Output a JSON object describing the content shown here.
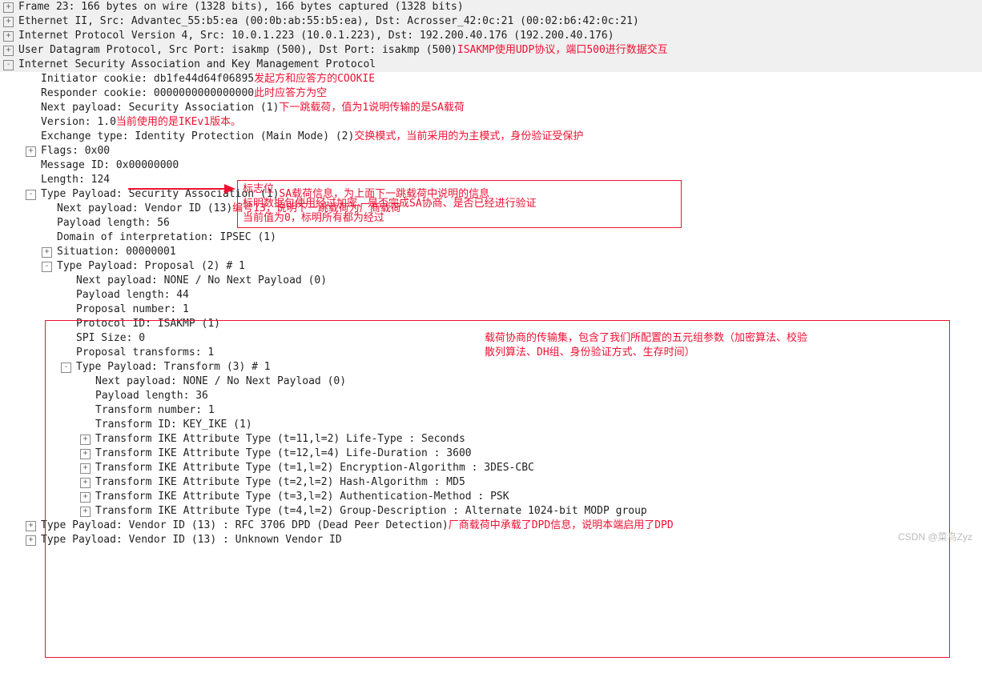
{
  "watermark": "CSDN @菜鸟Zyz",
  "lines": [
    {
      "hdr": true,
      "toggle": "+",
      "indent": 0,
      "text": "Frame 23: 166 bytes on wire (1328 bits), 166 bytes captured (1328 bits)"
    },
    {
      "hdr": true,
      "toggle": "+",
      "indent": 0,
      "text": "Ethernet II, Src: Advantec_55:b5:ea (00:0b:ab:55:b5:ea), Dst: Acrosser_42:0c:21 (00:02:b6:42:0c:21)"
    },
    {
      "hdr": true,
      "toggle": "+",
      "indent": 0,
      "text": "Internet Protocol Version 4, Src: 10.0.1.223 (10.0.1.223), Dst: 192.200.40.176 (192.200.40.176)"
    },
    {
      "hdr": true,
      "toggle": "+",
      "indent": 0,
      "text": "User Datagram Protocol, Src Port: isakmp (500), Dst Port: isakmp (500)",
      "annot": "ISAKMP使用UDP协议，端口500进行数据交互"
    },
    {
      "hdr": true,
      "toggle": "-",
      "indent": 0,
      "text": "Internet Security Association and Key Management Protocol"
    },
    {
      "hdr": false,
      "toggle": " ",
      "indent": 1,
      "text": "Initiator cookie: db1fe44d64f06895",
      "annot": "发起方和应答方的COOKIE"
    },
    {
      "hdr": false,
      "toggle": " ",
      "indent": 1,
      "text": "Responder cookie: 0000000000000000",
      "annot": "此时应答方为空"
    },
    {
      "hdr": false,
      "toggle": " ",
      "indent": 1,
      "text": "Next payload: Security Association (1)",
      "annot": "  下一跳载荷，值为1说明传输的是SA载荷"
    },
    {
      "hdr": false,
      "toggle": " ",
      "indent": 1,
      "text": "Version: 1.0",
      "annot": " 当前使用的是IKEv1版本。"
    },
    {
      "hdr": false,
      "toggle": " ",
      "indent": 1,
      "text": "Exchange type: Identity Protection (Main Mode) (2)",
      "annot": "交换模式，当前采用的为主模式，身份验证受保护"
    },
    {
      "hdr": false,
      "toggle": "+",
      "indent": 1,
      "text": "Flags: 0x00"
    },
    {
      "hdr": false,
      "toggle": " ",
      "indent": 1,
      "text": "Message ID: 0x00000000"
    },
    {
      "hdr": false,
      "toggle": " ",
      "indent": 1,
      "text": "Length: 124"
    },
    {
      "hdr": false,
      "toggle": "-",
      "indent": 1,
      "text": "Type Payload: Security Association (1)",
      "annot": "SA载荷信息，为上面下一跳载荷中说明的信息"
    },
    {
      "hdr": false,
      "toggle": " ",
      "indent": 2,
      "text": "Next payload: Vendor ID (13)",
      "annot": "编号13，说明下一跳载荷为厂商载荷"
    },
    {
      "hdr": false,
      "toggle": " ",
      "indent": 2,
      "text": "Payload length: 56"
    },
    {
      "hdr": false,
      "toggle": " ",
      "indent": 2,
      "text": "Domain of interpretation: IPSEC (1)"
    },
    {
      "hdr": false,
      "toggle": "+",
      "indent": 2,
      "text": "Situation: 00000001"
    },
    {
      "hdr": false,
      "toggle": "-",
      "indent": 2,
      "text": "Type Payload: Proposal (2) # 1"
    },
    {
      "hdr": false,
      "toggle": " ",
      "indent": 3,
      "text": "Next payload: NONE / No Next Payload  (0)"
    },
    {
      "hdr": false,
      "toggle": " ",
      "indent": 3,
      "text": "Payload length: 44"
    },
    {
      "hdr": false,
      "toggle": " ",
      "indent": 3,
      "text": "Proposal number: 1"
    },
    {
      "hdr": false,
      "toggle": " ",
      "indent": 3,
      "text": "Protocol ID: ISAKMP (1)"
    },
    {
      "hdr": false,
      "toggle": " ",
      "indent": 3,
      "text": "SPI Size: 0"
    },
    {
      "hdr": false,
      "toggle": " ",
      "indent": 3,
      "text": "Proposal transforms: 1"
    },
    {
      "hdr": false,
      "toggle": "-",
      "indent": 3,
      "text": "Type Payload: Transform (3) # 1"
    },
    {
      "hdr": false,
      "toggle": " ",
      "indent": 4,
      "text": "Next payload: NONE / No Next Payload  (0)"
    },
    {
      "hdr": false,
      "toggle": " ",
      "indent": 4,
      "text": "Payload length: 36"
    },
    {
      "hdr": false,
      "toggle": " ",
      "indent": 4,
      "text": "Transform number: 1"
    },
    {
      "hdr": false,
      "toggle": " ",
      "indent": 4,
      "text": "Transform ID: KEY_IKE (1)"
    },
    {
      "hdr": false,
      "toggle": "+",
      "indent": 4,
      "text": "Transform IKE Attribute Type (t=11,l=2) Life-Type : Seconds"
    },
    {
      "hdr": false,
      "toggle": "+",
      "indent": 4,
      "text": "Transform IKE Attribute Type (t=12,l=4) Life-Duration : 3600"
    },
    {
      "hdr": false,
      "toggle": "+",
      "indent": 4,
      "text": "Transform IKE Attribute Type (t=1,l=2) Encryption-Algorithm : 3DES-CBC"
    },
    {
      "hdr": false,
      "toggle": "+",
      "indent": 4,
      "text": "Transform IKE Attribute Type (t=2,l=2) Hash-Algorithm : MD5"
    },
    {
      "hdr": false,
      "toggle": "+",
      "indent": 4,
      "text": "Transform IKE Attribute Type (t=3,l=2) Authentication-Method : PSK"
    },
    {
      "hdr": false,
      "toggle": "+",
      "indent": 4,
      "text": "Transform IKE Attribute Type (t=4,l=2) Group-Description : Alternate 1024-bit MODP group"
    },
    {
      "hdr": false,
      "toggle": "+",
      "indent": 1,
      "text": "Type Payload: Vendor ID (13) : RFC 3706 DPD (Dead Peer Detection)",
      "annot": "厂商载荷中承载了DPD信息，说明本端启用了DPD"
    },
    {
      "hdr": false,
      "toggle": "+",
      "indent": 1,
      "text": "Type Payload: Vendor ID (13) : Unknown Vendor ID"
    }
  ],
  "flagsNote": {
    "l1": "标志位",
    "l2": "标明数据包使用经过加密、是否完成SA协商、是否已经进行验证",
    "l3": "当前值为0，标明所有都为经过"
  },
  "proposalNote": {
    "l1": "载荷协商的传输集，包含了我们所配置的五元组参数（加密算法、校验",
    "l2": "散列算法、DH组、身份验证方式、生存时间）"
  }
}
